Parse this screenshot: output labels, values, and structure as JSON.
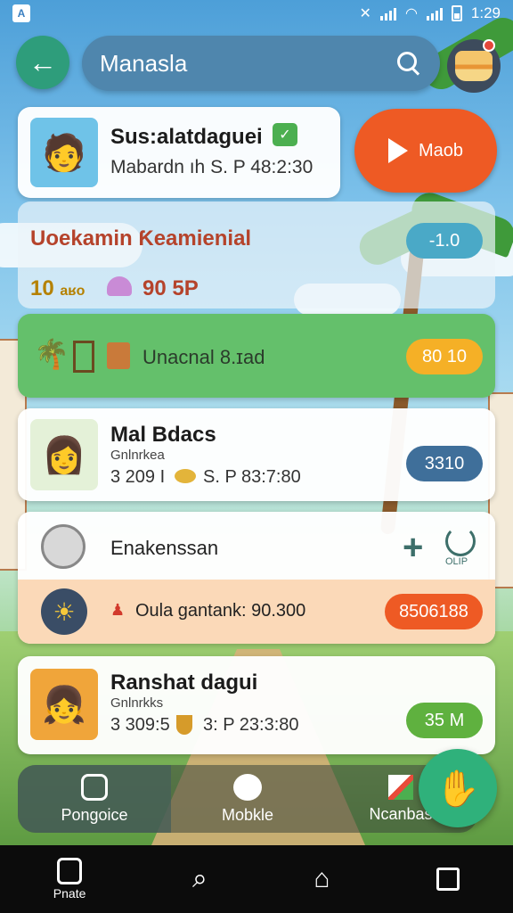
{
  "status_bar": {
    "time": "1:29"
  },
  "header": {
    "search_text": "Manasla"
  },
  "featured_card": {
    "title": "Sus:alatdaguei",
    "subtitle": "Mabardn ıh S. P 48:2:30",
    "play_label": "Maob"
  },
  "info_card": {
    "heading": "Uoekamin Ƙeamienial",
    "badge": "-1.0",
    "stat_left": "10",
    "stat_left_unit": "aʁo",
    "stat_right": "90 5P"
  },
  "green_card": {
    "label": "Unacnal 8.ɪad",
    "badge": "80 10"
  },
  "list_cards": [
    {
      "title": "Mal Bdacs",
      "small": "Gnlnrkea",
      "detail": "3 209 I",
      "detail2": "S. P 83:7:80",
      "badge": "3310",
      "badge_color": "#3f6f9a"
    },
    {
      "title": "Ranshat dagui",
      "small": "Gnlnrkks",
      "detail": "3 309:5",
      "detail2": "3: P 23:3:80",
      "badge": "35 M",
      "badge_color": "#5fb13f"
    }
  ],
  "activity_card": {
    "title": "Enakenssan",
    "sub_label": "Oula gantank: 90.300",
    "badge": "8506188",
    "extra_icon_label": "OLIP"
  },
  "bottom_nav": [
    {
      "label": "Pongoice"
    },
    {
      "label": "Mobkle"
    },
    {
      "label": "Ncanbas"
    }
  ],
  "system_nav": {
    "home_label": "Pnate"
  },
  "colors": {
    "primary_green": "#2e9d7b",
    "play_orange": "#ee5a24",
    "fab_green": "#2fb17b"
  }
}
